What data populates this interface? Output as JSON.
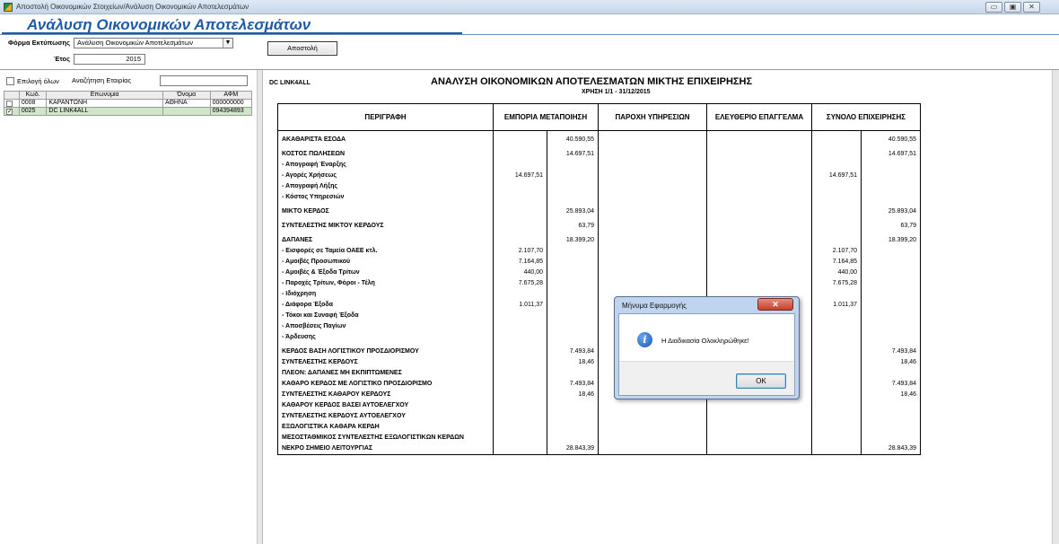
{
  "window": {
    "title": "Αποστολή Οικονομικών Στοιχείων/Ανάλυση Οικονομικών Αποτελεσμάτων",
    "minimize": "▭",
    "maximize": "▣",
    "close": "✕"
  },
  "page": {
    "title": "Ανάλυση Οικονομικών Αποτελεσμάτων"
  },
  "form": {
    "form_label": "Φόρμα Εκτύπωσης",
    "form_value": "Ανάλυση Οικονομικών Αποτελεσμάτων",
    "year_label": "Έτος",
    "year_value": "2015",
    "send_button": "Αποστολή"
  },
  "companies": {
    "select_all_label": "Επιλογή όλων",
    "search_label": "Αναζήτηση Εταιρίας",
    "search_value": "",
    "columns": [
      "Κωδ.",
      "Επωνυμία",
      "Όνομα",
      "ΑΦΜ"
    ],
    "rows": [
      {
        "checked": "",
        "code": "0008",
        "name": "ΚΑΡΑΝΤΩΝΗ",
        "first": "ΑΘΗΝΑ",
        "afm": "000000000"
      },
      {
        "checked": "✓",
        "code": "0025",
        "name": "DC LINK4ALL",
        "first": "",
        "afm": "094394893"
      }
    ]
  },
  "report": {
    "company": "DC LINK4ALL",
    "title": "ΑΝΑΛΥΣΗ ΟΙΚΟΝΟΜΙΚΩΝ ΑΠΟΤΕΛΕΣΜΑΤΩΝ ΜΙΚΤΗΣ ΕΠΙΧΕΙΡΗΣΗΣ",
    "subtitle": "ΧΡΗΣΗ 1/1 - 31/12/2015",
    "headers": {
      "desc": "ΠΕΡΙΓΡΑΦΗ",
      "trade": "ΕΜΠΟΡΙΑ ΜΕΤΑΠΟΙΗΣΗ",
      "services": "ΠΑΡΟΧΗ ΥΠΗΡΕΣΙΩΝ",
      "freelance": "ΕΛΕΥΘΕΡΙΟ ΕΠΑΓΓΕΛΜΑ",
      "total": "ΣΥΝΟΛΟ ΕΠΙΧΕΙΡΗΣΗΣ"
    },
    "rows": [
      {
        "desc": "ΑΚΑΘΑΡΙΣΤΑ ΕΣΟΔΑ",
        "tsub": "",
        "ttot": "40.590,55",
        "stot": "",
        "ftot": "",
        "osub": "",
        "otot": "40.590,55"
      },
      {
        "desc": "ΚΟΣΤΟΣ ΠΩΛΗΣΕΩΝ",
        "tsub": "",
        "ttot": "14.697,51",
        "stot": "",
        "ftot": "",
        "osub": "",
        "otot": "14.697,51"
      },
      {
        "desc": "- Απογραφή Έναρξης",
        "tsub": "",
        "ttot": "",
        "stot": "",
        "ftot": "",
        "osub": "",
        "otot": ""
      },
      {
        "desc": "- Αγορές Χρήσεως",
        "tsub": "14.697,51",
        "ttot": "",
        "stot": "",
        "ftot": "",
        "osub": "14.697,51",
        "otot": ""
      },
      {
        "desc": "- Απογραφή Λήξης",
        "tsub": "",
        "ttot": "",
        "stot": "",
        "ftot": "",
        "osub": "",
        "otot": ""
      },
      {
        "desc": "- Κόστος Υπηρεσιών",
        "tsub": "",
        "ttot": "",
        "stot": "",
        "ftot": "",
        "osub": "",
        "otot": ""
      },
      {
        "desc": "ΜΙΚΤΟ ΚΕΡΔΟΣ",
        "tsub": "",
        "ttot": "25.893,04",
        "stot": "",
        "ftot": "",
        "osub": "",
        "otot": "25.893,04"
      },
      {
        "desc": "ΣΥΝΤΕΛΕΣΤΗΣ ΜΙΚΤΟΥ ΚΕΡΔΟΥΣ",
        "tsub": "",
        "ttot": "63,79",
        "stot": "",
        "ftot": "",
        "osub": "",
        "otot": "63,79"
      },
      {
        "desc": "ΔΑΠΑΝΕΣ",
        "tsub": "",
        "ttot": "18.399,20",
        "stot": "",
        "ftot": "",
        "osub": "",
        "otot": "18.399,20"
      },
      {
        "desc": "- Εισφορές σε Ταμεία ΟΑΕΕ κτλ.",
        "tsub": "2.107,70",
        "ttot": "",
        "stot": "",
        "ftot": "",
        "osub": "2.107,70",
        "otot": ""
      },
      {
        "desc": "- Αμοιβές Προσωπικού",
        "tsub": "7.164,85",
        "ttot": "",
        "stot": "",
        "ftot": "",
        "osub": "7.164,85",
        "otot": ""
      },
      {
        "desc": "- Αμοιβές & Έξοδα Τρίτων",
        "tsub": "440,00",
        "ttot": "",
        "stot": "",
        "ftot": "",
        "osub": "440,00",
        "otot": ""
      },
      {
        "desc": "- Παροχές Τρίτων, Φόροι - Τέλη",
        "tsub": "7.675,28",
        "ttot": "",
        "stot": "",
        "ftot": "",
        "osub": "7.675,28",
        "otot": ""
      },
      {
        "desc": "- Ιδιόχρηση",
        "tsub": "",
        "ttot": "",
        "stot": "",
        "ftot": "",
        "osub": "",
        "otot": ""
      },
      {
        "desc": "- Διάφορα Έξοδα",
        "tsub": "1.011,37",
        "ttot": "",
        "stot": "",
        "ftot": "",
        "osub": "1.011,37",
        "otot": ""
      },
      {
        "desc": "- Τόκοι και Συναφή Έξοδα",
        "tsub": "",
        "ttot": "",
        "stot": "",
        "ftot": "",
        "osub": "",
        "otot": ""
      },
      {
        "desc": "- Αποσβέσεις Παγίων",
        "tsub": "",
        "ttot": "",
        "stot": "",
        "ftot": "",
        "osub": "",
        "otot": ""
      },
      {
        "desc": "- Άρδευσης",
        "tsub": "",
        "ttot": "",
        "stot": "",
        "ftot": "",
        "osub": "",
        "otot": ""
      },
      {
        "desc": "ΚΕΡΔΟΣ ΒΑΣΗ ΛΟΓΙΣΤΙΚΟΥ ΠΡΟΣΔΙΟΡΙΣΜΟΥ",
        "tsub": "",
        "ttot": "7.493,84",
        "stot": "",
        "ftot": "",
        "osub": "",
        "otot": "7.493,84"
      },
      {
        "desc": "ΣΥΝΤΕΛΕΣΤΗΣ ΚΕΡΔΟΥΣ",
        "tsub": "",
        "ttot": "18,46",
        "stot": "",
        "ftot": "",
        "osub": "",
        "otot": "18,46"
      },
      {
        "desc": "ΠΛΕΟΝ: ΔΑΠΑΝΕΣ ΜΗ ΕΚΠΙΠΤΩΜΕΝΕΣ",
        "tsub": "",
        "ttot": "",
        "stot": "",
        "ftot": "",
        "osub": "",
        "otot": ""
      },
      {
        "desc": "ΚΑΘΑΡΟ ΚΕΡΔΟΣ ΜΕ ΛΟΓΙΣΤΙΚΟ ΠΡΟΣΔΙΟΡΙΣΜΟ",
        "tsub": "",
        "ttot": "7.493,84",
        "stot": "",
        "ftot": "",
        "osub": "",
        "otot": "7.493,84"
      },
      {
        "desc": "ΣΥΝΤΕΛΕΣΤΗΣ ΚΑΘΑΡΟΥ ΚΕΡΔΟΥΣ",
        "tsub": "",
        "ttot": "18,46",
        "stot": "",
        "ftot": "",
        "osub": "",
        "otot": "18,46"
      },
      {
        "desc": "ΚΑΘΑΡΟΥ ΚΕΡΔΟΣ ΒΑΣΕΙ ΑΥΤΟΕΛΕΓΧΟΥ",
        "tsub": "",
        "ttot": "",
        "stot": "",
        "ftot": "",
        "osub": "",
        "otot": ""
      },
      {
        "desc": "ΣΥΝΤΕΛΕΣΤΗΣ ΚΕΡΔΟΥΣ ΑΥΤΟΕΛΕΓΧΟΥ",
        "tsub": "",
        "ttot": "",
        "stot": "",
        "ftot": "",
        "osub": "",
        "otot": ""
      },
      {
        "desc": "ΕΞΩΛΟΓΙΣΤΙΚΑ ΚΑΘΑΡΑ ΚΕΡΔΗ",
        "tsub": "",
        "ttot": "",
        "stot": "",
        "ftot": "",
        "osub": "",
        "otot": ""
      },
      {
        "desc": "ΜΕΣΟΣΤΑΘΜΙΚΟΣ ΣΥΝΤΕΛΕΣΤΗΣ ΕΞΩΛΟΓΙΣΤΙΚΩΝ ΚΕΡΔΩΝ",
        "tsub": "",
        "ttot": "",
        "stot": "",
        "ftot": "",
        "osub": "",
        "otot": ""
      },
      {
        "desc": "ΝΕΚΡΟ ΣΗΜΕΙΟ ΛΕΙΤΟΥΡΓΙΑΣ",
        "tsub": "",
        "ttot": "28.843,39",
        "stot": "",
        "ftot": "",
        "osub": "",
        "otot": "28.843,39"
      }
    ]
  },
  "dialog": {
    "title": "Μήνυμα Εφαρμογής",
    "close": "✕",
    "icon": "info-icon",
    "icon_glyph": "i",
    "message": "Η Διαδικασία Ολοκληρώθηκε!",
    "ok": "OK"
  }
}
